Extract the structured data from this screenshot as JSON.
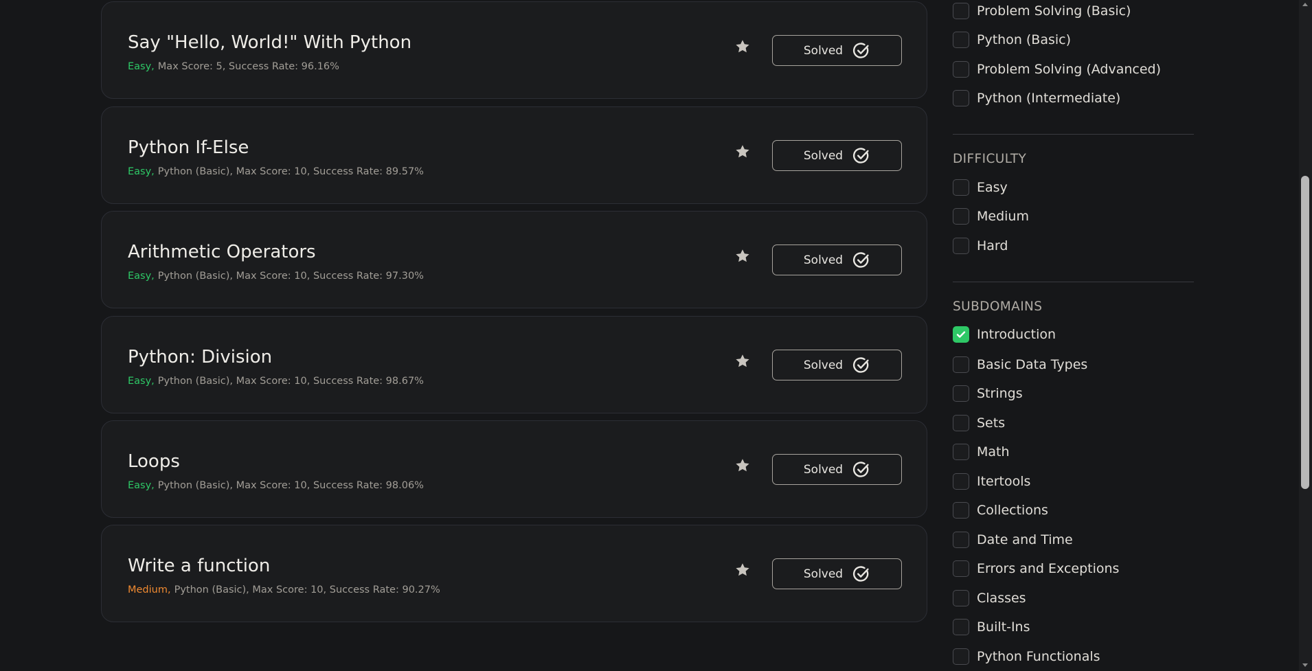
{
  "challenges": [
    {
      "title": "Say \"Hello, World!\" With Python",
      "difficulty": "Easy,",
      "difficulty_level": "easy",
      "info": "Max Score: 5, Success Rate: 96.16%",
      "button": "Solved"
    },
    {
      "title": "Python If-Else",
      "difficulty": "Easy,",
      "difficulty_level": "easy",
      "info": "Python (Basic), Max Score: 10, Success Rate: 89.57%",
      "button": "Solved"
    },
    {
      "title": "Arithmetic Operators",
      "difficulty": "Easy,",
      "difficulty_level": "easy",
      "info": "Python (Basic), Max Score: 10, Success Rate: 97.30%",
      "button": "Solved"
    },
    {
      "title": "Python: Division",
      "difficulty": "Easy,",
      "difficulty_level": "easy",
      "info": "Python (Basic), Max Score: 10, Success Rate: 98.67%",
      "button": "Solved"
    },
    {
      "title": "Loops",
      "difficulty": "Easy,",
      "difficulty_level": "easy",
      "info": "Python (Basic), Max Score: 10, Success Rate: 98.06%",
      "button": "Solved"
    },
    {
      "title": "Write a function",
      "difficulty": "Medium,",
      "difficulty_level": "medium",
      "info": "Python (Basic), Max Score: 10, Success Rate: 90.27%",
      "button": "Solved"
    }
  ],
  "filters": {
    "skills": [
      {
        "label": "Problem Solving (Basic)",
        "checked": false
      },
      {
        "label": "Python (Basic)",
        "checked": false
      },
      {
        "label": "Problem Solving (Advanced)",
        "checked": false
      },
      {
        "label": "Python (Intermediate)",
        "checked": false
      }
    ],
    "difficulty_title": "DIFFICULTY",
    "difficulty": [
      {
        "label": "Easy",
        "checked": false
      },
      {
        "label": "Medium",
        "checked": false
      },
      {
        "label": "Hard",
        "checked": false
      }
    ],
    "subdomains_title": "SUBDOMAINS",
    "subdomains": [
      {
        "label": "Introduction",
        "checked": true
      },
      {
        "label": "Basic Data Types",
        "checked": false
      },
      {
        "label": "Strings",
        "checked": false
      },
      {
        "label": "Sets",
        "checked": false
      },
      {
        "label": "Math",
        "checked": false
      },
      {
        "label": "Itertools",
        "checked": false
      },
      {
        "label": "Collections",
        "checked": false
      },
      {
        "label": "Date and Time",
        "checked": false
      },
      {
        "label": "Errors and Exceptions",
        "checked": false
      },
      {
        "label": "Classes",
        "checked": false
      },
      {
        "label": "Built-Ins",
        "checked": false
      },
      {
        "label": "Python Functionals",
        "checked": false
      }
    ]
  },
  "colors": {
    "easy": "#2ec866",
    "medium": "#f08a31",
    "checkbox_checked": "#2ec866",
    "background": "#161719",
    "card": "#1b1c1e"
  },
  "icons": {
    "star": "star-icon",
    "solved": "check-circle-icon",
    "checkbox_tick": "check-icon"
  }
}
